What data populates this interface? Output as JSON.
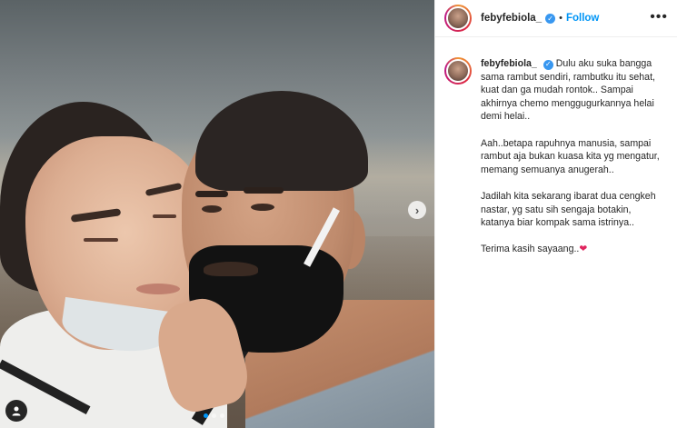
{
  "post": {
    "carousel": {
      "slide_count": 3,
      "active_index": 0
    }
  },
  "header": {
    "username": "febyfebiola_",
    "separator": "•",
    "follow_label": "Follow",
    "more_label": "•••"
  },
  "caption": {
    "username": "febyfebiola_",
    "paragraphs": [
      "Dulu aku suka bangga sama rambut sendiri, rambutku itu sehat, kuat dan ga mudah rontok.. Sampai akhirnya chemo menggugurkannya helai demi helai..",
      "Aah..betapa rapuhnya manusia, sampai rambut aja bukan kuasa kita yg mengatur, memang semuanya anugerah..",
      "Jadilah kita sekarang ibarat dua cengkeh nastar, yg satu sih sengaja botakin, katanya biar kompak sama istrinya..",
      "Terima kasih sayaang.."
    ],
    "emoji": "❤"
  },
  "icons": {
    "verified": "verified-badge-icon",
    "next": "chevron-right-icon",
    "tag": "user-tag-icon"
  },
  "colors": {
    "follow": "#0095f6",
    "verified": "#3897f0",
    "heart": "#e0245e"
  }
}
